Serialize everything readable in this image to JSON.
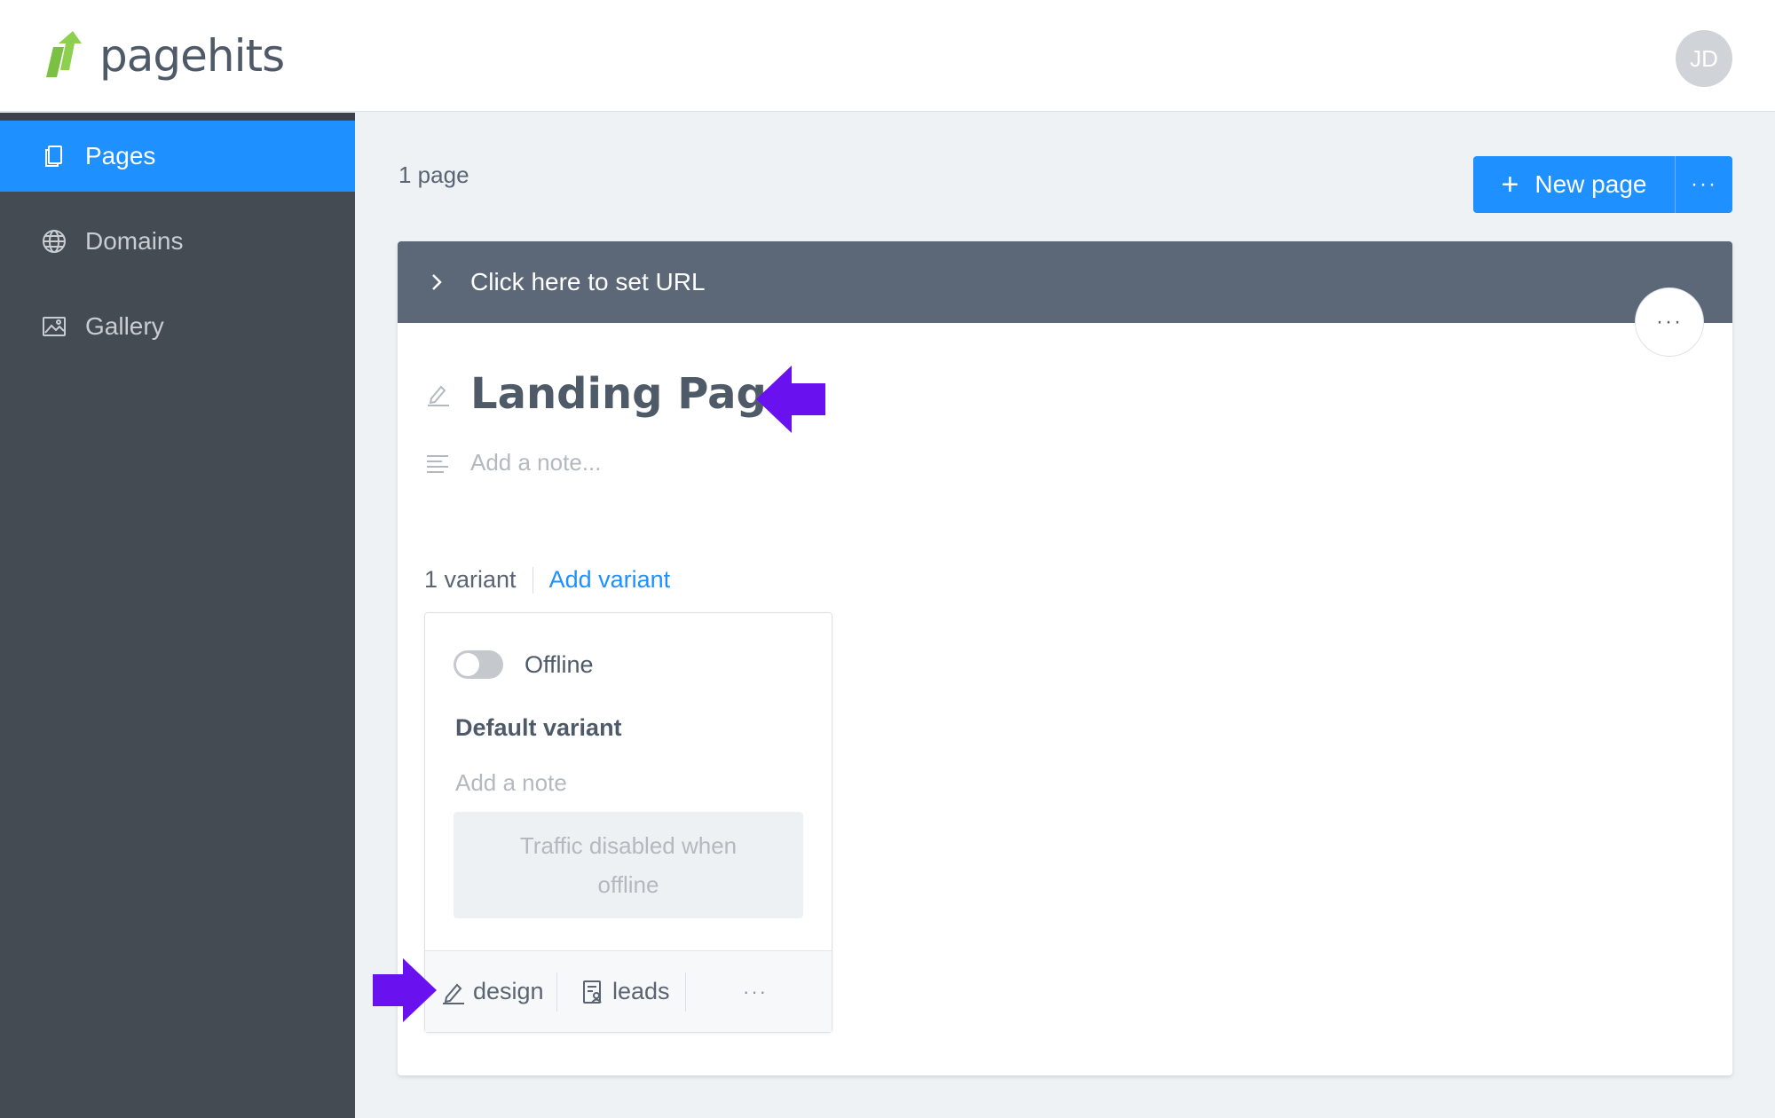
{
  "header": {
    "logo_text": "pagehits",
    "avatar_initials": "JD"
  },
  "sidebar": {
    "items": [
      {
        "label": "Pages",
        "icon": "pages-icon",
        "active": true
      },
      {
        "label": "Domains",
        "icon": "globe-icon",
        "active": false
      },
      {
        "label": "Gallery",
        "icon": "image-icon",
        "active": false
      }
    ]
  },
  "main": {
    "page_count": "1 page",
    "new_page_label": "New page",
    "more_label": "···"
  },
  "card": {
    "url_prompt": "Click here to set URL",
    "more_label": "···",
    "title": "Landing Page",
    "note_placeholder": "Add a note...",
    "variant_count": "1 variant",
    "add_variant_label": "Add variant"
  },
  "variant": {
    "status_label": "Offline",
    "name": "Default variant",
    "note_placeholder": "Add a note",
    "traffic_message": "Traffic disabled when offline",
    "design_label": "design",
    "leads_label": "leads",
    "more_label": "···"
  },
  "colors": {
    "accent": "#1e90ff",
    "sidebar": "#444b52",
    "url_bar": "#5c6878",
    "annotation_arrow": "#6a11f0",
    "logo_green": "#7ac143"
  }
}
